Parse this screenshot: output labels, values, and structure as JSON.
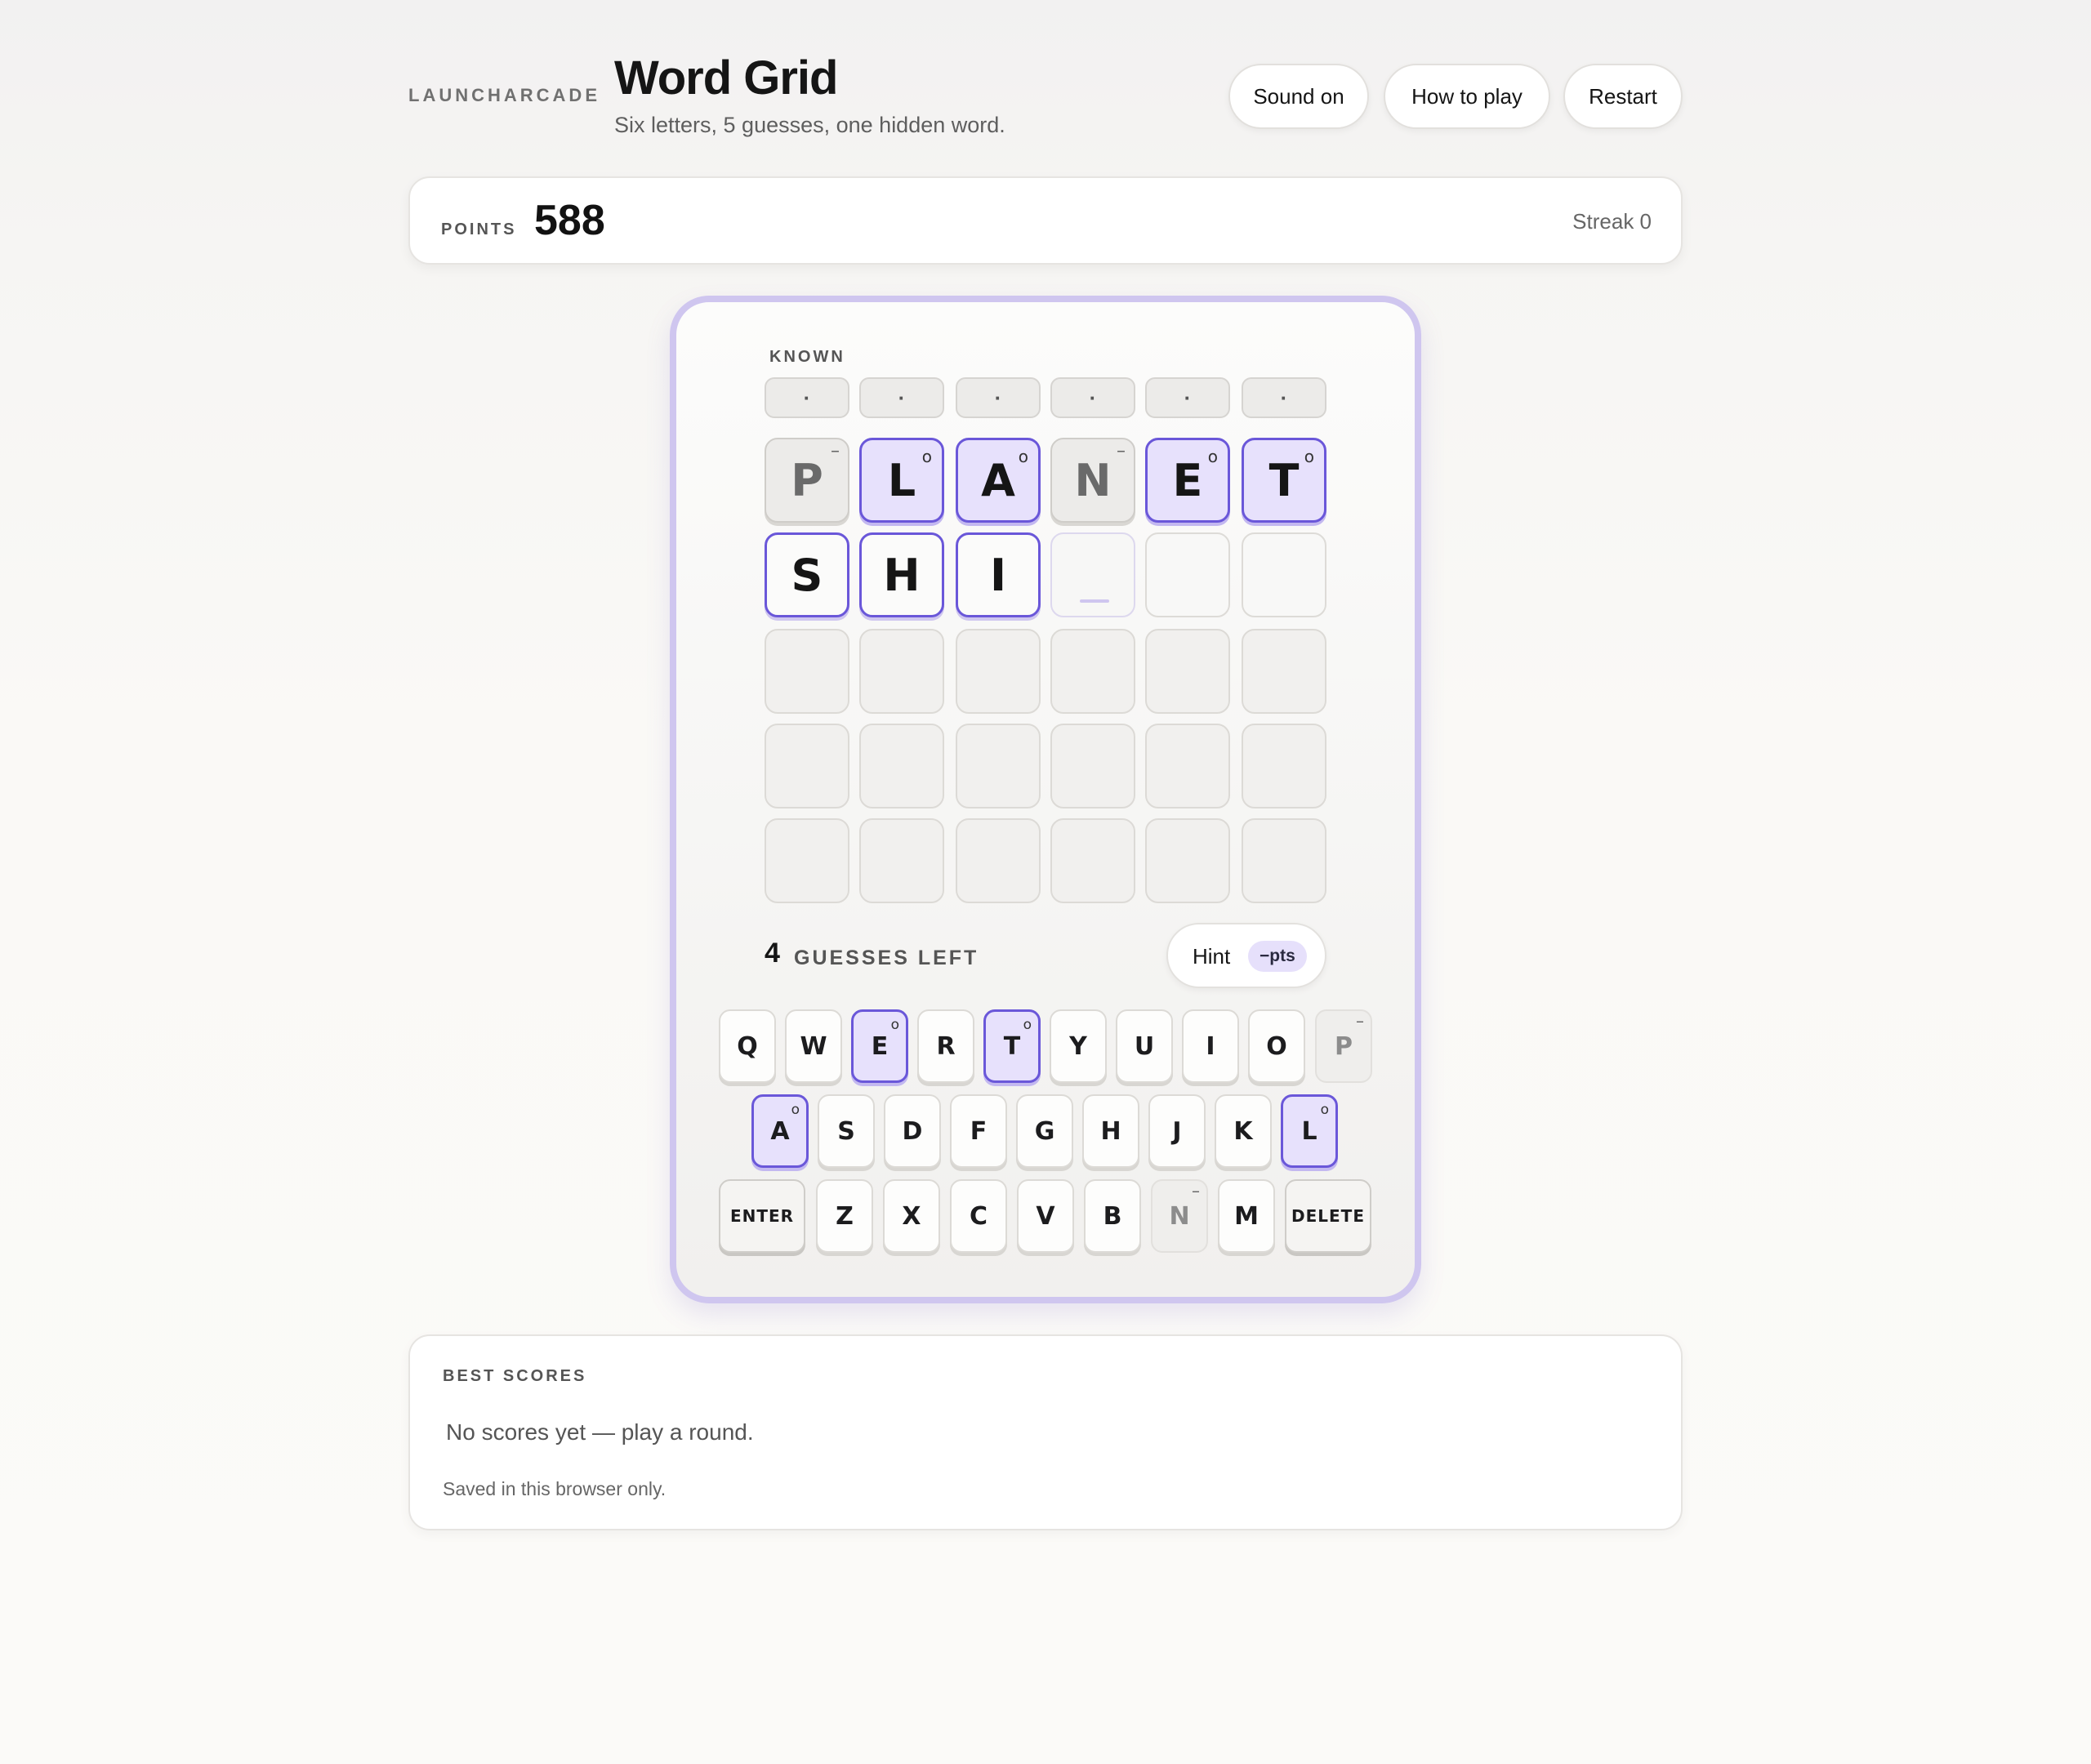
{
  "header": {
    "brand": "LAUNCHARCADE",
    "title": "Word Grid",
    "subtitle": "Six letters, 5 guesses, one hidden word.",
    "buttons": {
      "sound": "Sound on",
      "how_to_play": "How to play",
      "restart": "Restart"
    }
  },
  "score": {
    "label": "POINTS",
    "value": "588",
    "streak": "Streak 0"
  },
  "known": {
    "label": "KNOWN",
    "slots": [
      "·",
      "·",
      "·",
      "·",
      "·",
      "·"
    ]
  },
  "grid": {
    "row1": [
      {
        "letter": "P",
        "state": "absent",
        "mark": "–"
      },
      {
        "letter": "L",
        "state": "present",
        "mark": "o"
      },
      {
        "letter": "A",
        "state": "present",
        "mark": "o"
      },
      {
        "letter": "N",
        "state": "absent",
        "mark": "–"
      },
      {
        "letter": "E",
        "state": "present",
        "mark": "o"
      },
      {
        "letter": "T",
        "state": "present",
        "mark": "o"
      }
    ],
    "row2": [
      "S",
      "H",
      "I",
      "",
      "",
      ""
    ]
  },
  "guesses": {
    "count": "4",
    "label": "GUESSES LEFT"
  },
  "hint": {
    "label": "Hint",
    "cost": "−pts"
  },
  "keyboard": {
    "row1": [
      "Q",
      "W",
      "E",
      "R",
      "T",
      "Y",
      "U",
      "I",
      "O",
      "P"
    ],
    "row2": [
      "A",
      "S",
      "D",
      "F",
      "G",
      "H",
      "J",
      "K",
      "L"
    ],
    "row3": [
      "Z",
      "X",
      "C",
      "V",
      "B",
      "N",
      "M"
    ],
    "enter": "ENTER",
    "delete": "DELETE",
    "present_mark": "o",
    "absent_mark": "–"
  },
  "best_scores": {
    "title": "BEST SCORES",
    "empty": "No scores yet — play a round.",
    "note": "Saved in this browser only."
  },
  "colors": {
    "accent": "#6a57d9",
    "present_fill": "#e7e1fc",
    "card_border": "#cfc6ef"
  }
}
